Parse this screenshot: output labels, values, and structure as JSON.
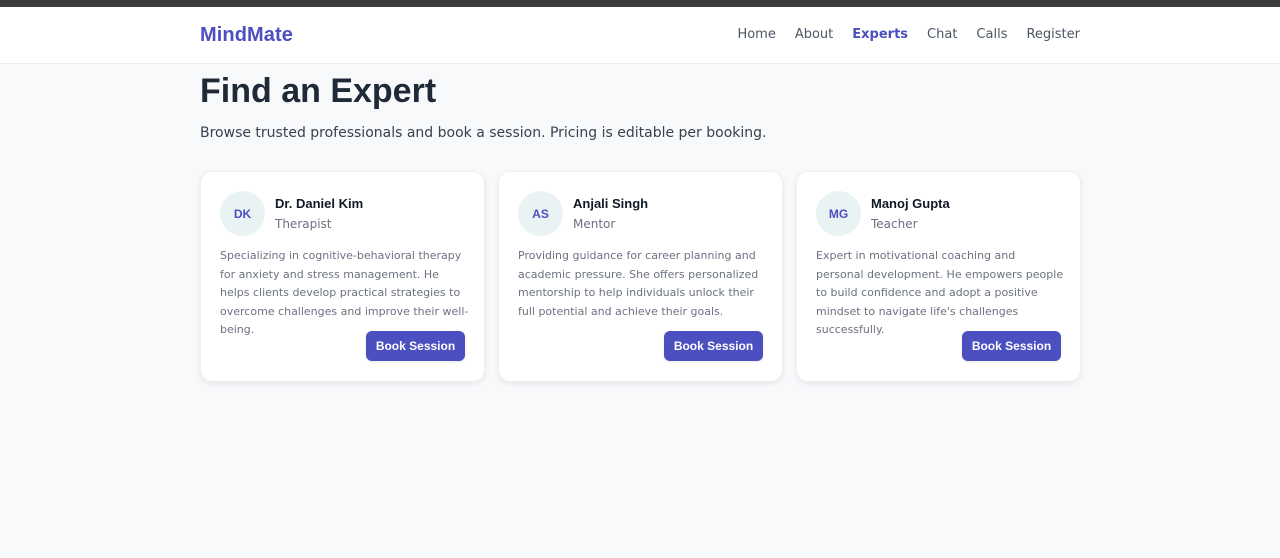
{
  "header": {
    "brand": "MindMate",
    "nav": [
      "Home",
      "About",
      "Experts",
      "Chat",
      "Calls",
      "Register"
    ],
    "active_nav": "Experts"
  },
  "main": {
    "title": "Find an Expert",
    "subtitle": "Browse trusted professionals and book a session. Pricing is editable per booking.",
    "experts": [
      {
        "initials": "DK",
        "name": "Dr. Daniel Kim",
        "role": "Therapist",
        "description": "Specializing in cognitive-behavioral therapy for anxiety and stress management. He helps clients develop practical strategies to overcome challenges and improve their well-being.",
        "button": "Book Session"
      },
      {
        "initials": "AS",
        "name": "Anjali Singh",
        "role": "Mentor",
        "description": "Providing guidance for career planning and academic pressure. She offers personalized mentorship to help individuals unlock their full potential and achieve their goals.",
        "button": "Book Session"
      },
      {
        "initials": "MG",
        "name": "Manoj Gupta",
        "role": "Teacher",
        "description": "Expert in motivational coaching and personal development. He empowers people to build confidence and adopt a positive mindset to navigate life's challenges successfully.",
        "button": "Book Session"
      }
    ]
  },
  "colors": {
    "brand": "#4b4fbf",
    "background": "#f8f9fb",
    "avatar_bg": "#eaf3f4"
  }
}
